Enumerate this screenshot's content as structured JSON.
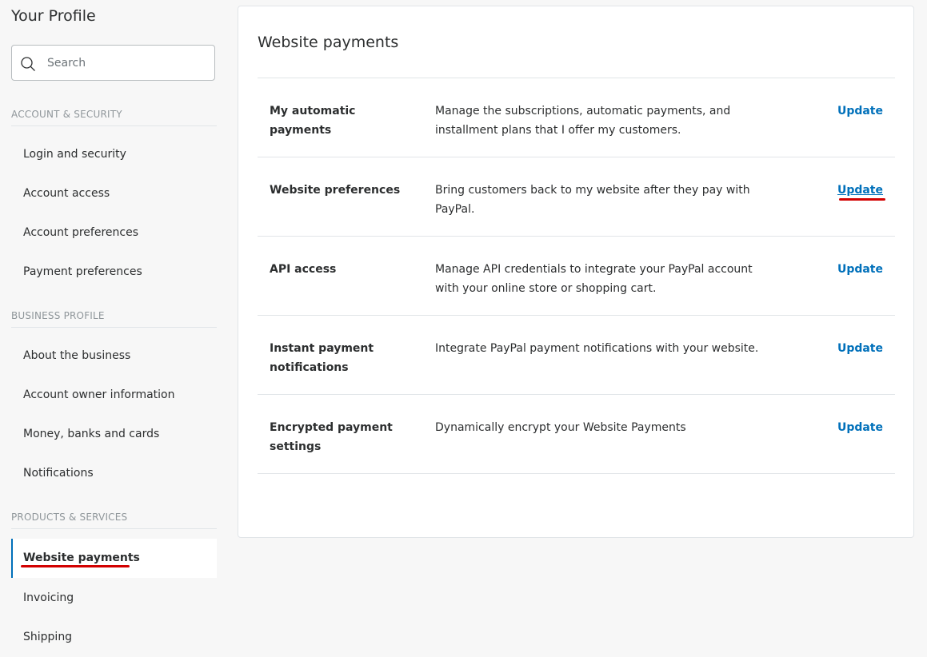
{
  "sidebar": {
    "title": "Your Profile",
    "search": {
      "placeholder": "Search"
    },
    "sections": [
      {
        "header": "ACCOUNT & SECURITY",
        "items": [
          "Login and security",
          "Account access",
          "Account preferences",
          "Payment preferences"
        ]
      },
      {
        "header": "BUSINESS PROFILE",
        "items": [
          "About the business",
          "Account owner information",
          "Money, banks and cards",
          "Notifications"
        ]
      },
      {
        "header": "PRODUCTS & SERVICES",
        "items": [
          "Website payments",
          "Invoicing",
          "Shipping"
        ]
      }
    ],
    "active_item": "Website payments"
  },
  "main": {
    "title": "Website payments",
    "rows": [
      {
        "name": "My automatic payments",
        "description": "Manage the subscriptions, automatic payments, and installment plans that I offer my customers.",
        "action": "Update"
      },
      {
        "name": "Website preferences",
        "description": "Bring customers back to my website after they pay with PayPal.",
        "action": "Update"
      },
      {
        "name": "API access",
        "description": "Manage API credentials to integrate your PayPal account with your online store or shopping cart.",
        "action": "Update"
      },
      {
        "name": "Instant payment notifications",
        "description": "Integrate PayPal payment notifications with your website.",
        "action": "Update"
      },
      {
        "name": "Encrypted payment settings",
        "description": "Dynamically encrypt your Website Payments",
        "action": "Update"
      }
    ]
  },
  "colors": {
    "accent": "#0070ba",
    "highlight": "#d20000",
    "background": "#f7f7f7"
  }
}
